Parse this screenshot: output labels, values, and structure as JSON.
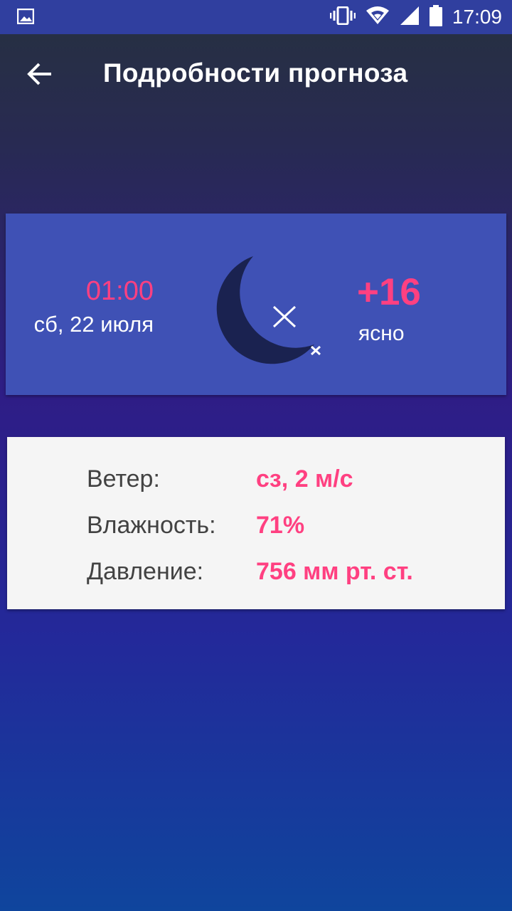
{
  "status_bar": {
    "time": "17:09",
    "icons": [
      "image-icon",
      "vibrate-icon",
      "wifi-icon",
      "signal-icon",
      "battery-icon"
    ]
  },
  "toolbar": {
    "back_icon": "arrow-left-icon",
    "title": "Подробности прогноза"
  },
  "forecast": {
    "time": "01:00",
    "date": "сб, 22 июля",
    "weather_icon": "moon-stars-icon",
    "temperature": "+16",
    "condition": "ясно"
  },
  "details": {
    "wind_label": "Ветер:",
    "wind_value": "сз, 2 м/с",
    "humidity_label": "Влажность:",
    "humidity_value": "71%",
    "pressure_label": "Давление:",
    "pressure_value": "756 мм рт. ст."
  },
  "colors": {
    "accent": "#ff4081",
    "card": "#3f51b5",
    "status_bar": "#303f9f",
    "moon": "#1a2250"
  }
}
